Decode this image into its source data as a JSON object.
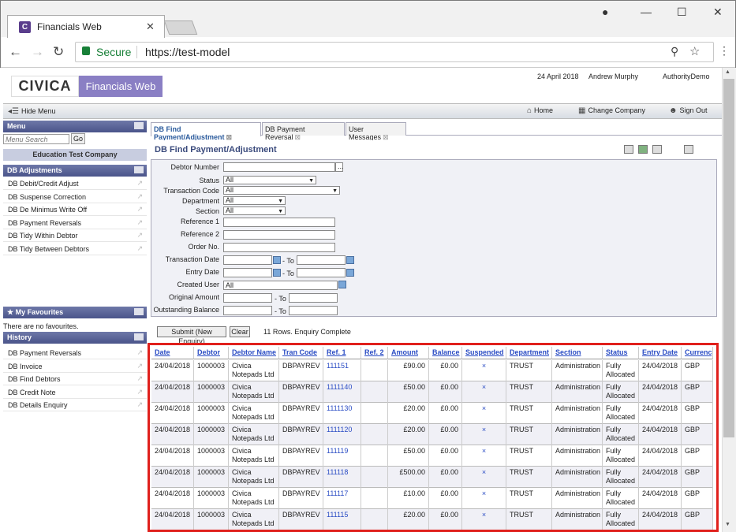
{
  "browser": {
    "tab_title": "Financials Web",
    "favicon_letter": "C",
    "secure_label": "Secure",
    "url": "https://test-model"
  },
  "header": {
    "logo_text": "CIVICA",
    "app_name": "Financials Web",
    "date": "24 April 2018",
    "user": "Andrew Murphy",
    "authority": "AuthorityDemo"
  },
  "menubar": {
    "hide_menu": "Hide Menu",
    "home": "Home",
    "change_company": "Change Company",
    "sign_out": "Sign Out"
  },
  "sidebar": {
    "menu_title": "Menu",
    "search_placeholder": "Menu Search",
    "go_label": "Go",
    "company": "Education Test Company",
    "adjustments_title": "DB Adjustments",
    "adjustments": [
      "DB Debit/Credit Adjust",
      "DB Suspense Correction",
      "DB De Minimus Write Off",
      "DB Payment Reversals",
      "DB Tidy Within Debtor",
      "DB Tidy Between Debtors"
    ],
    "favourites_title": "My Favourites",
    "no_favourites": "There are no favourites.",
    "history_title": "History",
    "history": [
      "DB Payment Reversals",
      "DB Invoice",
      "DB Find Debtors",
      "DB Credit Note",
      "DB Details Enquiry"
    ]
  },
  "tabs": [
    "DB Find Payment/Adjustment",
    "DB Payment Reversal",
    "User Messages"
  ],
  "panel": {
    "title": "DB Find Payment/Adjustment"
  },
  "form": {
    "debtor_number": "Debtor Number",
    "status": "Status",
    "status_value": "All",
    "transaction_code": "Transaction Code",
    "transaction_code_value": "All",
    "department": "Department",
    "department_value": "All",
    "section": "Section",
    "section_value": "All",
    "reference1": "Reference 1",
    "reference2": "Reference 2",
    "order_no": "Order No.",
    "transaction_date": "Transaction Date",
    "entry_date": "Entry Date",
    "created_user": "Created User",
    "created_user_value": "All",
    "original_amount": "Original Amount",
    "outstanding_balance": "Outstanding Balance",
    "to": "- To",
    "ellipsis": "..."
  },
  "actions": {
    "submit": "Submit (New Enquiry)",
    "clear": "Clear",
    "status": "11 Rows. Enquiry Complete"
  },
  "table": {
    "columns": [
      "Date",
      "Debtor",
      "Debtor Name",
      "Tran Code",
      "Ref. 1",
      "Ref. 2",
      "Amount",
      "Balance",
      "Suspended",
      "Department",
      "Section",
      "Status",
      "Entry Date",
      "Currency"
    ],
    "rows": [
      {
        "date": "24/04/2018",
        "debtor": "1000003",
        "name1": "Civica",
        "name2": "Notepads Ltd",
        "tran": "DBPAYREV",
        "ref1": "111151",
        "ref2": "",
        "amount": "£90.00",
        "balance": "£0.00",
        "suspended": "×",
        "dept": "TRUST",
        "section": "Administration",
        "status1": "Fully",
        "status2": "Allocated",
        "entry": "24/04/2018",
        "currency": "GBP"
      },
      {
        "date": "24/04/2018",
        "debtor": "1000003",
        "name1": "Civica",
        "name2": "Notepads Ltd",
        "tran": "DBPAYREV",
        "ref1": "1111140",
        "ref2": "",
        "amount": "£50.00",
        "balance": "£0.00",
        "suspended": "×",
        "dept": "TRUST",
        "section": "Administration",
        "status1": "Fully",
        "status2": "Allocated",
        "entry": "24/04/2018",
        "currency": "GBP"
      },
      {
        "date": "24/04/2018",
        "debtor": "1000003",
        "name1": "Civica",
        "name2": "Notepads Ltd",
        "tran": "DBPAYREV",
        "ref1": "1111130",
        "ref2": "",
        "amount": "£20.00",
        "balance": "£0.00",
        "suspended": "×",
        "dept": "TRUST",
        "section": "Administration",
        "status1": "Fully",
        "status2": "Allocated",
        "entry": "24/04/2018",
        "currency": "GBP"
      },
      {
        "date": "24/04/2018",
        "debtor": "1000003",
        "name1": "Civica",
        "name2": "Notepads Ltd",
        "tran": "DBPAYREV",
        "ref1": "1111120",
        "ref2": "",
        "amount": "£20.00",
        "balance": "£0.00",
        "suspended": "×",
        "dept": "TRUST",
        "section": "Administration",
        "status1": "Fully",
        "status2": "Allocated",
        "entry": "24/04/2018",
        "currency": "GBP"
      },
      {
        "date": "24/04/2018",
        "debtor": "1000003",
        "name1": "Civica",
        "name2": "Notepads Ltd",
        "tran": "DBPAYREV",
        "ref1": "111119",
        "ref2": "",
        "amount": "£50.00",
        "balance": "£0.00",
        "suspended": "×",
        "dept": "TRUST",
        "section": "Administration",
        "status1": "Fully",
        "status2": "Allocated",
        "entry": "24/04/2018",
        "currency": "GBP"
      },
      {
        "date": "24/04/2018",
        "debtor": "1000003",
        "name1": "Civica",
        "name2": "Notepads Ltd",
        "tran": "DBPAYREV",
        "ref1": "111118",
        "ref2": "",
        "amount": "£500.00",
        "balance": "£0.00",
        "suspended": "×",
        "dept": "TRUST",
        "section": "Administration",
        "status1": "Fully",
        "status2": "Allocated",
        "entry": "24/04/2018",
        "currency": "GBP"
      },
      {
        "date": "24/04/2018",
        "debtor": "1000003",
        "name1": "Civica",
        "name2": "Notepads Ltd",
        "tran": "DBPAYREV",
        "ref1": "111117",
        "ref2": "",
        "amount": "£10.00",
        "balance": "£0.00",
        "suspended": "×",
        "dept": "TRUST",
        "section": "Administration",
        "status1": "Fully",
        "status2": "Allocated",
        "entry": "24/04/2018",
        "currency": "GBP"
      },
      {
        "date": "24/04/2018",
        "debtor": "1000003",
        "name1": "Civica",
        "name2": "Notepads Ltd",
        "tran": "DBPAYREV",
        "ref1": "111115",
        "ref2": "",
        "amount": "£20.00",
        "balance": "£0.00",
        "suspended": "×",
        "dept": "TRUST",
        "section": "Administration",
        "status1": "Fully",
        "status2": "Allocated",
        "entry": "24/04/2018",
        "currency": "GBP"
      }
    ]
  },
  "colors": {
    "highlight": "#e0201c",
    "link": "#2a4cc4",
    "sidebar_header": "#4a548a"
  }
}
